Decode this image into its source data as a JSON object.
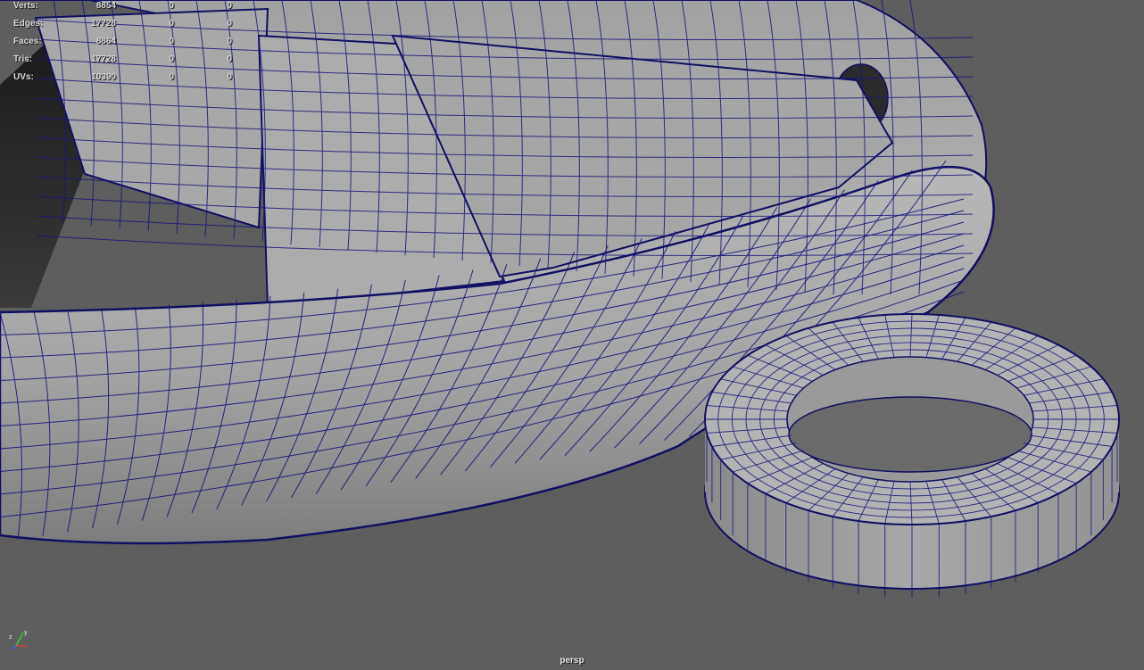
{
  "hud": {
    "rows": [
      {
        "label": "Verts:",
        "values": [
          "8854",
          "0",
          "0"
        ]
      },
      {
        "label": "Edges:",
        "values": [
          "17728",
          "0",
          "0"
        ]
      },
      {
        "label": "Faces:",
        "values": [
          "8864",
          "0",
          "0"
        ]
      },
      {
        "label": "Tris:",
        "values": [
          "17728",
          "0",
          "0"
        ]
      },
      {
        "label": "UVs:",
        "values": [
          "10390",
          "0",
          "0"
        ]
      }
    ]
  },
  "viewport": {
    "camera": "persp",
    "background_color": "#5e5e5e",
    "wireframe_color": "#14147a",
    "mesh_color": "#a9a9a9"
  },
  "axis_gizmo": {
    "x_label": "x",
    "y_label": "y",
    "z_label": "z"
  }
}
